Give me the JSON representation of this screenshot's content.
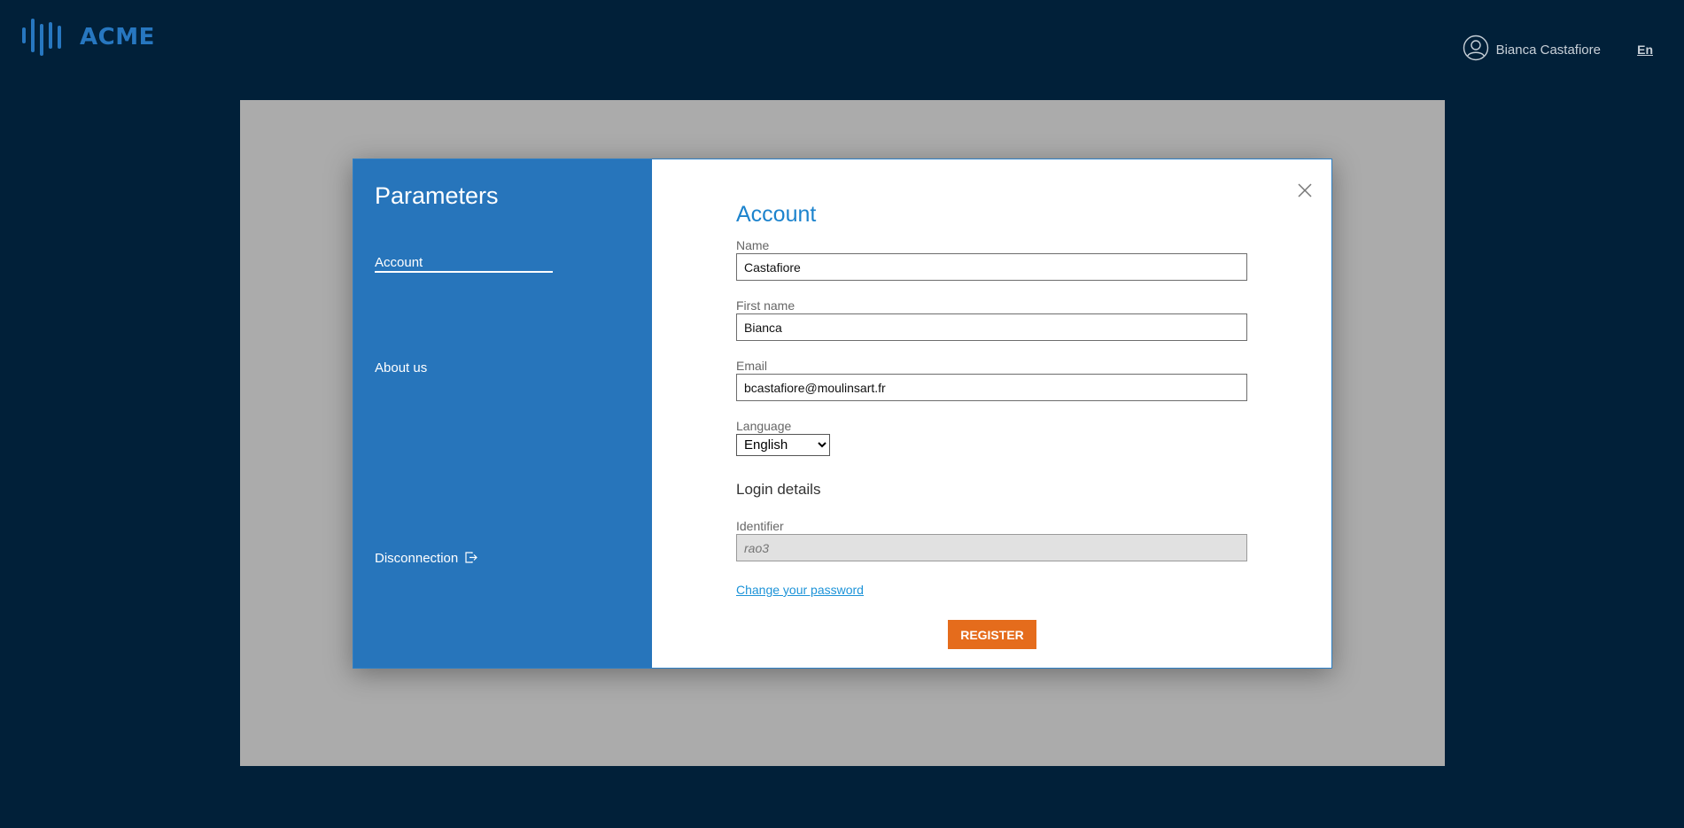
{
  "header": {
    "logo_text": "ACME",
    "user_name": "Bianca Castafiore",
    "language_short": "En"
  },
  "sidebar": {
    "title": "Parameters",
    "items": [
      {
        "label": "Account",
        "active": true
      },
      {
        "label": "About us",
        "active": false
      },
      {
        "label": "Disconnection",
        "active": false
      }
    ]
  },
  "form": {
    "title": "Account",
    "name_label": "Name",
    "name_value": "Castafiore",
    "first_name_label": "First name",
    "first_name_value": "Bianca",
    "email_label": "Email",
    "email_value": "bcastafiore@moulinsart.fr",
    "language_label": "Language",
    "language_value": "English",
    "login_section_title": "Login details",
    "identifier_label": "Identifier",
    "identifier_placeholder": "rao3",
    "change_password_label": "Change your password",
    "register_label": "REGISTER"
  },
  "colors": {
    "background": "#012039",
    "brand_blue": "#2775bb",
    "title_blue": "#1c83cd",
    "accent_orange": "#e56c1c",
    "backdrop_grey": "#ababab"
  },
  "icons": [
    "logo-icon",
    "user-avatar-icon",
    "close-icon",
    "exit-icon"
  ]
}
